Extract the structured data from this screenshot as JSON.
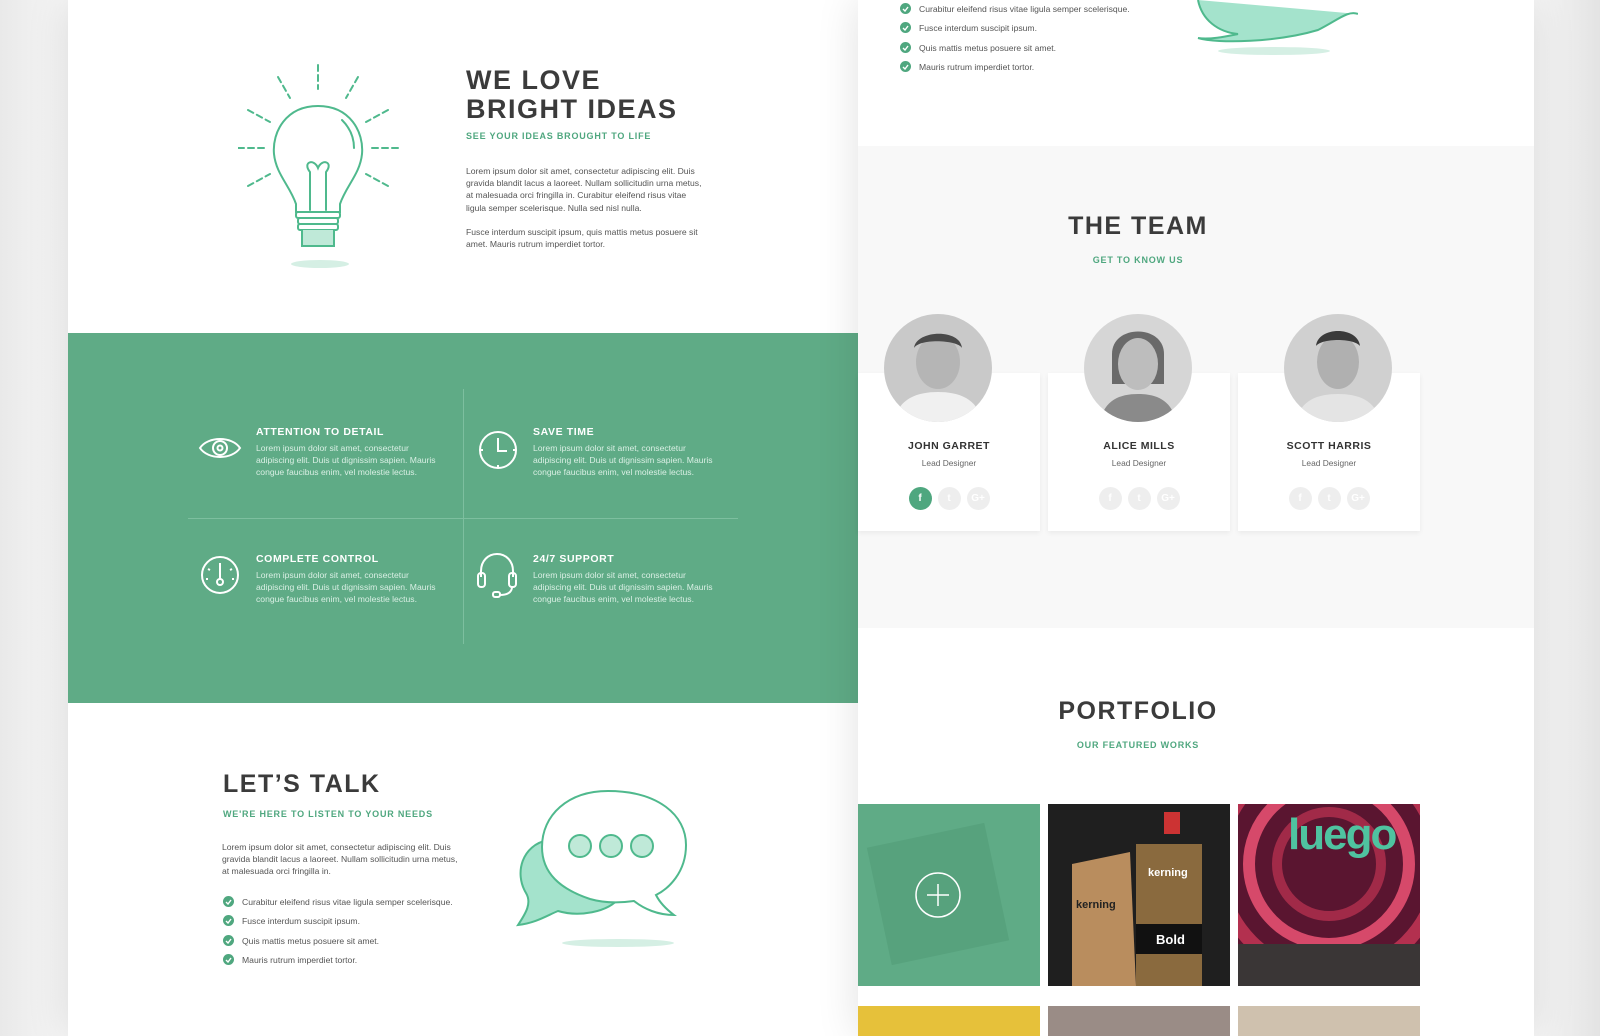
{
  "ideas": {
    "title_line1": "WE LOVE",
    "title_line2": "BRIGHT IDEAS",
    "subtitle": "SEE YOUR IDEAS BROUGHT TO LIFE",
    "p1": "Lorem ipsum dolor sit amet, consectetur adipiscing elit. Duis gravida blandit lacus a laoreet. Nullam sollicitudin urna metus, at malesuada orci fringilla in. Curabitur eleifend risus vitae ligula semper scelerisque. Nulla sed nisl nulla.",
    "p2": "Fusce interdum suscipit ipsum, quis mattis metus posuere sit amet. Mauris rutrum imperdiet tortor."
  },
  "features": [
    {
      "icon": "eye-icon",
      "title": "ATTENTION TO DETAIL",
      "text": "Lorem ipsum dolor sit amet, consectetur adipiscing elit. Duis ut dignissim sapien. Mauris congue faucibus enim, vel molestie lectus."
    },
    {
      "icon": "clock-icon",
      "title": "SAVE TIME",
      "text": "Lorem ipsum dolor sit amet, consectetur adipiscing elit. Duis ut dignissim sapien. Mauris congue faucibus enim, vel molestie lectus."
    },
    {
      "icon": "speedometer-icon",
      "title": "COMPLETE CONTROL",
      "text": "Lorem ipsum dolor sit amet, consectetur adipiscing elit. Duis ut dignissim sapien. Mauris congue faucibus enim, vel molestie lectus."
    },
    {
      "icon": "headset-icon",
      "title": "24/7 SUPPORT",
      "text": "Lorem ipsum dolor sit amet, consectetur adipiscing elit. Duis ut dignissim sapien. Mauris congue faucibus enim, vel molestie lectus."
    }
  ],
  "talk": {
    "title": "LET’S TALK",
    "subtitle": "WE'RE HERE TO LISTEN TO YOUR NEEDS",
    "p": "Lorem ipsum dolor sit amet, consectetur adipiscing elit. Duis gravida blandit lacus a laoreet. Nullam sollicitudin urna metus, at malesuada orci fringilla in.",
    "checks": [
      "Curabitur eleifend risus vitae ligula semper scelerisque.",
      "Fusce interdum suscipit ipsum.",
      "Quis mattis metus posuere sit amet.",
      "Mauris rutrum imperdiet tortor."
    ]
  },
  "top_checks": [
    "Curabitur eleifend risus vitae ligula semper scelerisque.",
    "Fusce interdum suscipit ipsum.",
    "Quis mattis metus posuere sit amet.",
    "Mauris rutrum imperdiet tortor."
  ],
  "team": {
    "title": "THE TEAM",
    "subtitle": "GET TO KNOW US",
    "members": [
      {
        "name": "JOHN GARRET",
        "role": "Lead Designer"
      },
      {
        "name": "ALICE MILLS",
        "role": "Lead Designer"
      },
      {
        "name": "SCOTT HARRIS",
        "role": "Lead Designer"
      }
    ],
    "social": {
      "facebook": "f",
      "twitter": "t",
      "google": "G+"
    }
  },
  "portfolio": {
    "title": "PORTFOLIO",
    "subtitle": "OUR FEATURED WORKS",
    "kerning1": "kerning",
    "kerning2": "kerning",
    "bold": "Bold",
    "luego": "luego"
  },
  "colors": {
    "accent": "#5fab86",
    "dark": "#3b3b3b"
  }
}
